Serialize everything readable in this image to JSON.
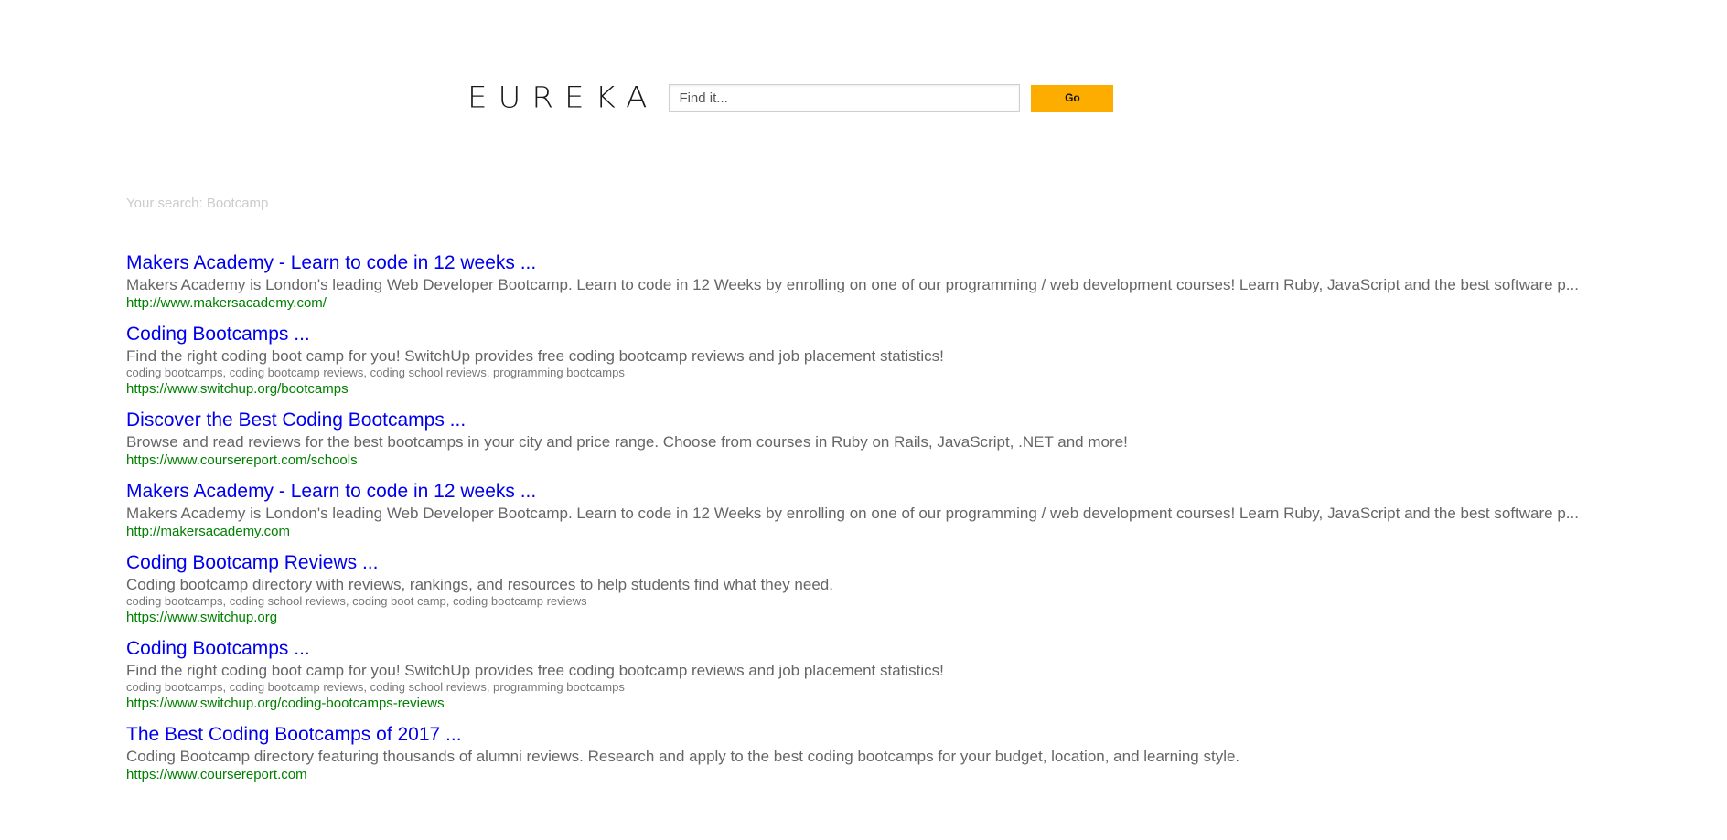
{
  "header": {
    "logo_text": "EUREKA",
    "search_placeholder": "Find it...",
    "search_value": "",
    "go_label": "Go",
    "accent_color": "#fcad00"
  },
  "search_summary": "Your search: Bootcamp",
  "results": [
    {
      "title": "Makers Academy - Learn to code in 12 weeks ...",
      "description": "Makers Academy is London's leading Web Developer Bootcamp. Learn to code in 12 Weeks by enrolling on one of our programming / web development courses! Learn Ruby, JavaScript and the best software p...",
      "keywords": "",
      "url": "http://www.makersacademy.com/"
    },
    {
      "title": "Coding Bootcamps ...",
      "description": "Find the right coding boot camp for you! SwitchUp provides free coding bootcamp reviews and job placement statistics!",
      "keywords": "coding bootcamps, coding bootcamp reviews, coding school reviews, programming bootcamps",
      "url": "https://www.switchup.org/bootcamps"
    },
    {
      "title": "Discover the Best Coding Bootcamps ...",
      "description": "Browse and read reviews for the best bootcamps in your city and price range. Choose from courses in Ruby on Rails, JavaScript, .NET and more!",
      "keywords": "",
      "url": "https://www.coursereport.com/schools"
    },
    {
      "title": "Makers Academy - Learn to code in 12 weeks ...",
      "description": "Makers Academy is London's leading Web Developer Bootcamp. Learn to code in 12 Weeks by enrolling on one of our programming / web development courses! Learn Ruby, JavaScript and the best software p...",
      "keywords": "",
      "url": "http://makersacademy.com"
    },
    {
      "title": "Coding Bootcamp Reviews ...",
      "description": "Coding bootcamp directory with reviews, rankings, and resources to help students find what they need.",
      "keywords": "coding bootcamps, coding school reviews, coding boot camp, coding bootcamp reviews",
      "url": "https://www.switchup.org"
    },
    {
      "title": "Coding Bootcamps ...",
      "description": "Find the right coding boot camp for you! SwitchUp provides free coding bootcamp reviews and job placement statistics!",
      "keywords": "coding bootcamps, coding bootcamp reviews, coding school reviews, programming bootcamps",
      "url": "https://www.switchup.org/coding-bootcamps-reviews"
    },
    {
      "title": "The Best Coding Bootcamps of 2017 ...",
      "description": "Coding Bootcamp directory featuring thousands of alumni reviews. Research and apply to the best coding bootcamps for your budget, location, and learning style.",
      "keywords": "",
      "url": "https://www.coursereport.com"
    }
  ]
}
